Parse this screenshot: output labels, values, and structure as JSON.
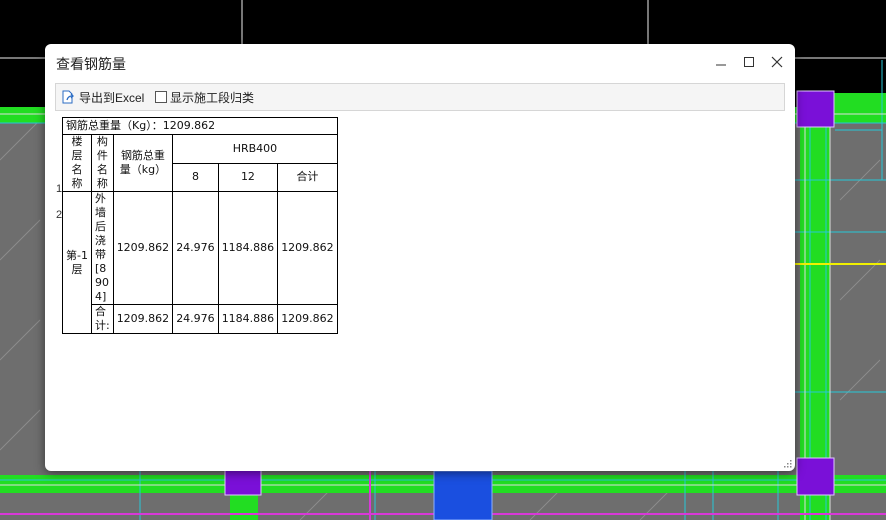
{
  "dialog": {
    "title": "查看钢筋量"
  },
  "toolbar": {
    "export_label": "导出到Excel",
    "checkbox_label": "显示施工段归类",
    "checkbox_checked": false
  },
  "table": {
    "summary": "钢筋总重量（Kg）：1209.862",
    "headers": {
      "floor": "楼层名称",
      "component": "构件名称",
      "total_weight": "钢筋总重量（kg）",
      "grade": "HRB400",
      "d8": "8",
      "d12": "12",
      "subtotal": "合计"
    },
    "rows": [
      {
        "num": "1",
        "floor": "第-1层",
        "component": "外墙后浇带[8904]",
        "total": "1209.862",
        "d8": "24.976",
        "d12": "1184.886",
        "subtotal": "1209.862"
      },
      {
        "num": "2",
        "component": "合计:",
        "total": "1209.862",
        "d8": "24.976",
        "d12": "1184.886",
        "subtotal": "1209.862"
      }
    ]
  },
  "colors": {
    "beam_green": "#22dd22",
    "column_purple": "#7a10d8",
    "cad_grey": "#6e6e6e",
    "cyan_line": "#27c8d8",
    "magenta_line": "#d838d8",
    "yellow_line": "#f0f000",
    "blue_block": "#1a4fe0"
  }
}
